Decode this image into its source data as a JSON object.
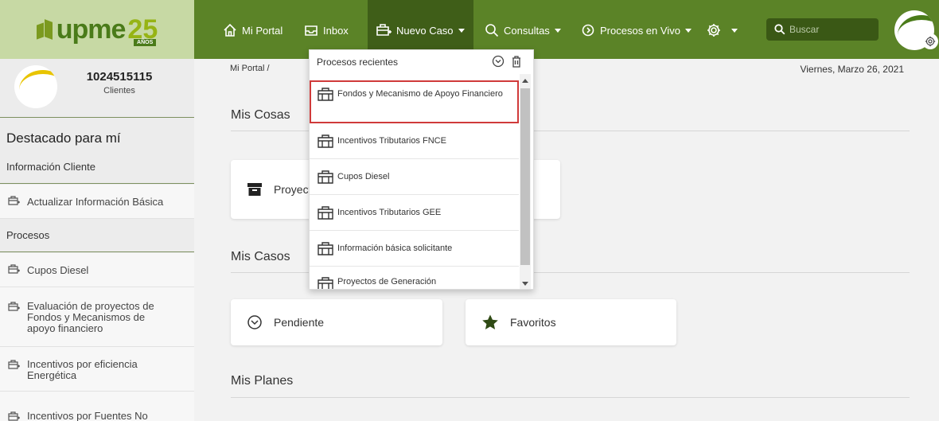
{
  "logo": {
    "text": "upme",
    "number": "25",
    "tag": "AÑOS"
  },
  "nav": {
    "mi_portal": "Mi Portal",
    "inbox": "Inbox",
    "nuevo_caso": "Nuevo Caso",
    "consultas": "Consultas",
    "procesos_en_vivo": "Procesos en Vivo",
    "search_placeholder": "Buscar"
  },
  "profile": {
    "id": "1024515115",
    "role": "Clientes"
  },
  "sidebar": {
    "heading": "Destacado para mí",
    "sections": [
      {
        "label": "Información Cliente",
        "items": [
          "Actualizar Información Básica"
        ]
      },
      {
        "label": "Procesos",
        "items": [
          "Cupos Diesel",
          "Evaluación de proyectos de Fondos y Mecanismos de apoyo financiero",
          "Incentivos por eficiencia Energética",
          "Incentivos por Fuentes No"
        ]
      }
    ]
  },
  "main": {
    "breadcrumb": "Mi Portal /",
    "date": "Viernes, Marzo 26, 2021",
    "sections": [
      "Mis Cosas",
      "Mis Casos",
      "Mis Planes"
    ],
    "cards": {
      "proyectos": "Proyectos",
      "pendiente": "Pendiente",
      "favoritos": "Favoritos"
    }
  },
  "dropdown": {
    "header": "Procesos recientes",
    "items": [
      "Fondos y Mecanismo de Apoyo Financiero",
      "Incentivos Tributarios FNCE",
      "Cupos Diesel",
      "Incentivos Tributarios GEE",
      "Información básica solicitante",
      "Proyectos de Generación"
    ]
  },
  "colors": {
    "nav_green": "#5b8327",
    "nav_active": "#3f5e18",
    "logo_bg": "#c7d9a4",
    "highlight": "#d03a3a"
  }
}
